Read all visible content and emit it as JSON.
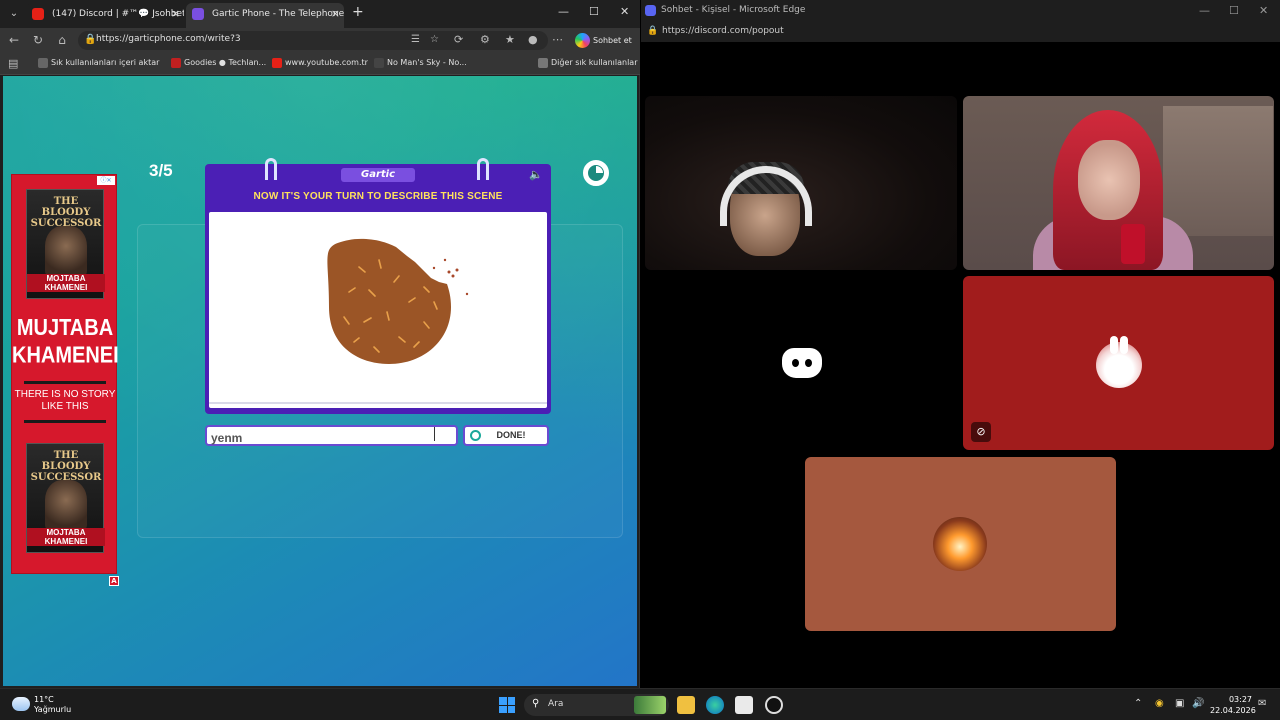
{
  "left_browser": {
    "tabs": [
      {
        "label": "(147) Discord | #™💬 Jsohbet",
        "active": false
      },
      {
        "label": "Gartic Phone - The Telephone Gam",
        "active": true
      }
    ],
    "url": "https://garticphone.com/write?3",
    "copilot_label": "Sohbet et",
    "bookmarks": [
      "Sık kullanılanları içeri aktar",
      "Goodies ● Techlan...",
      "www.youtube.com.tr",
      "No Man's Sky - No...",
      "Diğer sık kullanılanlar"
    ]
  },
  "ad": {
    "book_title": "THE BLOODY SUCCESSOR",
    "book_name": "MOJTABA KHAMENEI",
    "big_name": "MUJTABA KHAMENEI",
    "tagline": "THERE IS NO STORY LIKE THIS",
    "badge": "A"
  },
  "game": {
    "round": "3/5",
    "logo": "Gartic",
    "prompt": "NOW IT'S YOUR TURN TO DESCRIBE THIS SCENE",
    "answer_value": "yenm",
    "done_label": "DONE!"
  },
  "right_window": {
    "title": "Sohbet - Kişisel - Microsoft Edge",
    "url": "https://discord.com/popout"
  },
  "taskbar": {
    "temperature": "11°C",
    "weather": "Yağmurlu",
    "search_label": "Ara",
    "time": "03:27",
    "date": "22.04.2026"
  },
  "colors": {
    "sheet_purple": "#4b1fb5",
    "prompt_yellow": "#ffe25c",
    "discord_blurple": "#5865f2",
    "tile_red": "#a11c1c",
    "tile_brown": "#a5583e"
  }
}
